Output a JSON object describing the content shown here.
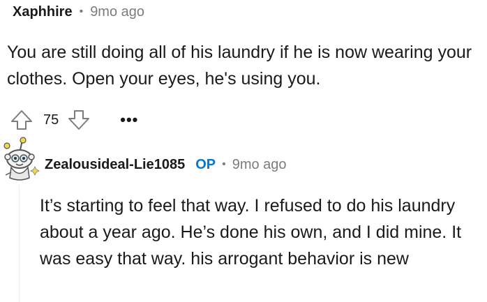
{
  "comment1": {
    "author": "Xaphhire",
    "separator": "•",
    "time": "9mo ago",
    "body": "You are still doing all of his laundry if he is now wearing your clothes. Open your eyes, he's using you.",
    "score": "75",
    "more_label": "•••"
  },
  "comment2": {
    "author": "Zealousideal-Lie1085",
    "op_badge": "OP",
    "separator": "•",
    "time": "9mo ago",
    "body": "It’s starting to feel that way. I refused to do his laundry about a year ago. He’s done his own, and I did mine. It was easy that way. his arrogant behavior is new"
  },
  "icons": {
    "upvote": "upvote-arrow-icon",
    "downvote": "downvote-arrow-icon",
    "avatar": "snoo-avatar-icon"
  },
  "colors": {
    "op": "#0079d3",
    "meta_gray": "#7c7c7c",
    "text": "#1a1a1b",
    "thread_line": "#edeff1"
  }
}
